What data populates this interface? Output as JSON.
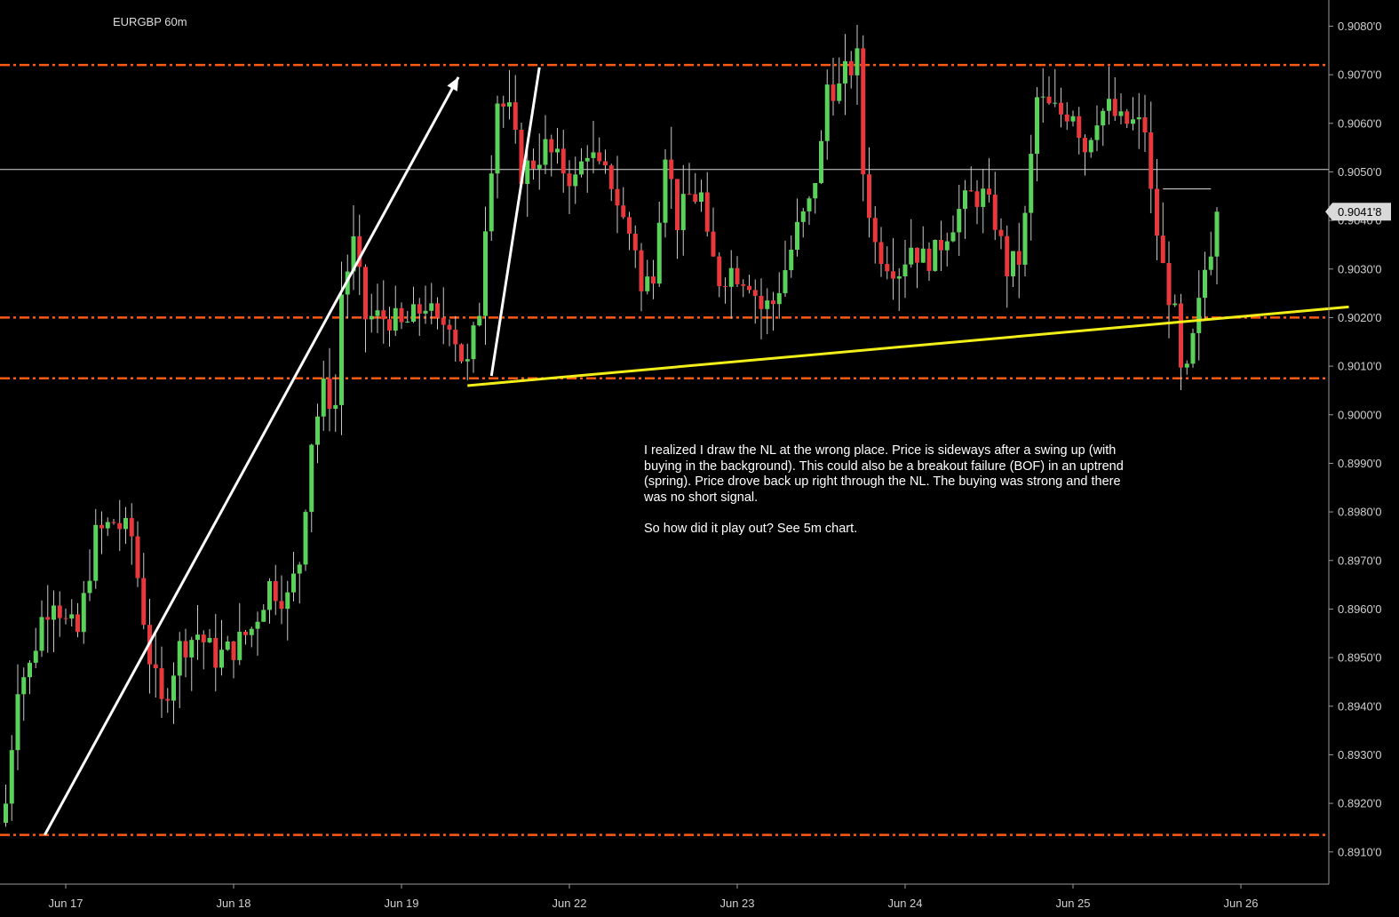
{
  "chart_data": {
    "type": "candlestick",
    "title": "EURGBP 60m",
    "symbol_timeframe": "EURGBP 60m",
    "ylim": [
      0.8902,
      0.9082
    ],
    "y_ticks": [
      "0.9080'0",
      "0.9070'0",
      "0.9060'0",
      "0.9050'0",
      "0.9040'0",
      "0.9030'0",
      "0.9020'0",
      "0.9010'0",
      "0.9000'0",
      "0.8990'0",
      "0.8980'0",
      "0.8970'0",
      "0.8960'0",
      "0.8950'0",
      "0.8940'0",
      "0.8930'0",
      "0.8920'0",
      "0.8910'0"
    ],
    "y_tick_values": [
      0.908,
      0.907,
      0.906,
      0.905,
      0.904,
      0.903,
      0.902,
      0.901,
      0.9,
      0.899,
      0.898,
      0.897,
      0.896,
      0.895,
      0.894,
      0.893,
      0.892,
      0.891
    ],
    "x_ticks": [
      "Jun 17",
      "Jun 18",
      "Jun 19",
      "Jun 22",
      "Jun 23",
      "Jun 24",
      "Jun 25",
      "Jun 26"
    ],
    "bar_count": 224,
    "x_tick_bar_index": [
      10,
      38,
      66,
      94,
      122,
      150,
      178,
      206
    ],
    "last_price": 0.90418,
    "last_price_label": "0.9041'8",
    "colors": {
      "up": "#5ad25a",
      "down": "#e8383b",
      "wick": "#c8c8c8",
      "level": "#ff5a14",
      "neckline": "#f2ee18",
      "arrow": "#ffffff"
    },
    "levels": [
      0.9072,
      0.902,
      0.90075,
      0.89135
    ],
    "reference_line": 0.90505,
    "neckline": {
      "from": [
        77,
        0.9006
      ],
      "to": [
        224,
        0.90222
      ]
    },
    "arrows": [
      {
        "from": [
          6.5,
          0.89135
        ],
        "to": [
          75.5,
          0.90695
        ]
      },
      {
        "from": [
          81,
          0.9008
        ],
        "to": [
          89,
          0.90715
        ]
      }
    ],
    "waypoints": [
      [
        0,
        0.892
      ],
      [
        2,
        0.8945
      ],
      [
        4,
        0.8948
      ],
      [
        6,
        0.8958
      ],
      [
        8,
        0.8963
      ],
      [
        10,
        0.8957
      ],
      [
        12,
        0.8955
      ],
      [
        15,
        0.8975
      ],
      [
        18,
        0.8978
      ],
      [
        21,
        0.8975
      ],
      [
        24,
        0.895
      ],
      [
        26,
        0.894
      ],
      [
        29,
        0.8952
      ],
      [
        32,
        0.8955
      ],
      [
        35,
        0.895
      ],
      [
        38,
        0.8952
      ],
      [
        41,
        0.8956
      ],
      [
        44,
        0.8965
      ],
      [
        47,
        0.8962
      ],
      [
        49,
        0.897
      ],
      [
        51,
        0.8995
      ],
      [
        53,
        0.9005
      ],
      [
        55,
        0.9002
      ],
      [
        56,
        0.9025
      ],
      [
        58,
        0.9035
      ],
      [
        60,
        0.902
      ],
      [
        62,
        0.902
      ],
      [
        64,
        0.902
      ],
      [
        66,
        0.9018
      ],
      [
        68,
        0.902
      ],
      [
        70,
        0.9023
      ],
      [
        72,
        0.9018
      ],
      [
        74,
        0.902
      ],
      [
        76,
        0.9012
      ],
      [
        77,
        0.901
      ],
      [
        79,
        0.9022
      ],
      [
        80,
        0.904
      ],
      [
        82,
        0.9065
      ],
      [
        84,
        0.9062
      ],
      [
        86,
        0.905
      ],
      [
        88,
        0.9052
      ],
      [
        90,
        0.9055
      ],
      [
        92,
        0.9052
      ],
      [
        95,
        0.9048
      ],
      [
        97,
        0.9055
      ],
      [
        99,
        0.905
      ],
      [
        101,
        0.9048
      ],
      [
        103,
        0.904
      ],
      [
        105,
        0.9035
      ],
      [
        106,
        0.9025
      ],
      [
        108,
        0.903
      ],
      [
        110,
        0.9055
      ],
      [
        112,
        0.904
      ],
      [
        114,
        0.9045
      ],
      [
        116,
        0.9045
      ],
      [
        117,
        0.9035
      ],
      [
        119,
        0.9028
      ],
      [
        121,
        0.903
      ],
      [
        124,
        0.9028
      ],
      [
        126,
        0.9022
      ],
      [
        128,
        0.9023
      ],
      [
        130,
        0.903
      ],
      [
        132,
        0.9038
      ],
      [
        134,
        0.9043
      ],
      [
        136,
        0.9055
      ],
      [
        137,
        0.9068
      ],
      [
        139,
        0.9067
      ],
      [
        140,
        0.907
      ],
      [
        142,
        0.9073
      ],
      [
        143,
        0.905
      ],
      [
        145,
        0.9035
      ],
      [
        147,
        0.9032
      ],
      [
        149,
        0.903
      ],
      [
        151,
        0.9035
      ],
      [
        153,
        0.9032
      ],
      [
        155,
        0.9033
      ],
      [
        157,
        0.9038
      ],
      [
        159,
        0.9042
      ],
      [
        161,
        0.9045
      ],
      [
        163,
        0.9045
      ],
      [
        165,
        0.904
      ],
      [
        167,
        0.903
      ],
      [
        169,
        0.9032
      ],
      [
        170,
        0.904
      ],
      [
        172,
        0.9065
      ],
      [
        174,
        0.9063
      ],
      [
        176,
        0.9062
      ],
      [
        178,
        0.9063
      ],
      [
        180,
        0.9055
      ],
      [
        182,
        0.9062
      ],
      [
        184,
        0.9063
      ],
      [
        186,
        0.906
      ],
      [
        188,
        0.906
      ],
      [
        190,
        0.9059
      ],
      [
        191,
        0.9045
      ],
      [
        193,
        0.903
      ],
      [
        195,
        0.902
      ],
      [
        196,
        0.9008
      ],
      [
        197,
        0.9008
      ],
      [
        198,
        0.9015
      ],
      [
        199,
        0.9022
      ],
      [
        200,
        0.903
      ],
      [
        202,
        0.904
      ]
    ],
    "annotation": "I realized I draw the NL at the wrong place. Price is sideways after a swing up (with buying in the background). This could also be a breakout failure (BOF) in an uptrend (spring). Price drove back up right through the NL. The buying was strong and there was no short signal.\n\nSo how did it play out? See 5m chart."
  }
}
